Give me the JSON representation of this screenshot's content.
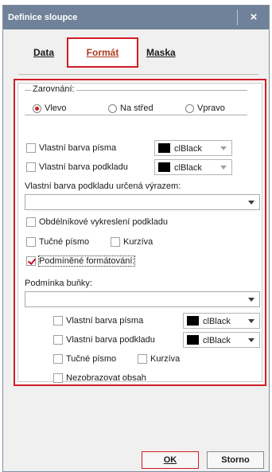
{
  "window": {
    "title": "Definice sloupce",
    "close_label": "×"
  },
  "tabs": [
    {
      "label": "Data",
      "active": false
    },
    {
      "label": "Formát",
      "active": true
    },
    {
      "label": "Maska",
      "active": false
    }
  ],
  "alignment": {
    "legend": "Zarovnání:",
    "options": [
      {
        "label": "Vlevo",
        "selected": true
      },
      {
        "label": "Na střed",
        "selected": false
      },
      {
        "label": "Vpravo",
        "selected": false
      }
    ]
  },
  "own_font_color": {
    "label": "Vlastní barva písma",
    "checked": false,
    "color_value": "clBlack"
  },
  "own_bg_color": {
    "label": "Vlastní barva podkladu",
    "checked": false,
    "color_value": "clBlack"
  },
  "bg_by_expression": {
    "label": "Vlastní barva podkladu určená výrazem:",
    "value": ""
  },
  "rect_bg": {
    "label": "Obdélníkové vykreslení podkladu",
    "checked": false
  },
  "bold": {
    "label": "Tučné písmo",
    "checked": false
  },
  "italic": {
    "label": "Kurzíva",
    "checked": false
  },
  "conditional": {
    "label": "Podmíněné formátování:",
    "checked": true
  },
  "cell_condition": {
    "label": "Podmínka buňky:",
    "value": ""
  },
  "cond_font_color": {
    "label": "Vlastní barva písma",
    "checked": false,
    "color_value": "clBlack"
  },
  "cond_bg_color": {
    "label": "Vlastní barva podkladu",
    "checked": false,
    "color_value": "clBlack"
  },
  "cond_bold": {
    "label": "Tučné písmo",
    "checked": false
  },
  "cond_italic": {
    "label": "Kurzíva",
    "checked": false
  },
  "cond_hide": {
    "label": "Nezobrazovat obsah",
    "checked": false
  },
  "buttons": {
    "ok": "OK",
    "cancel": "Storno"
  },
  "colors": {
    "titlebar": "#6f8299",
    "highlight": "#d01c24"
  }
}
